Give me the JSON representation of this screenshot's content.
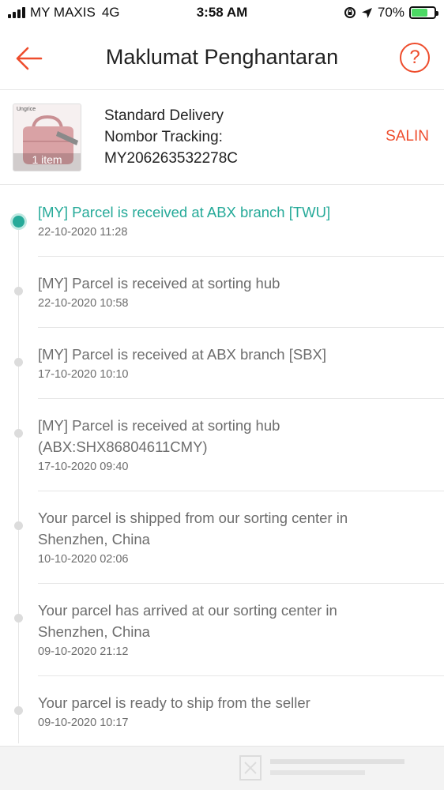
{
  "status_bar": {
    "carrier": "MY MAXIS",
    "network": "4G",
    "time": "3:58 AM",
    "battery": "70%",
    "battery_level": 0.7
  },
  "header": {
    "title": "Maklumat Penghantaran",
    "back_icon": "arrow-left-icon",
    "help_icon": "question-circle-icon",
    "help_label": "?"
  },
  "delivery": {
    "thumbnail_brand": "Ungrice",
    "item_count": "1 item",
    "method": "Standard Delivery",
    "tracking_label": "Nombor Tracking:",
    "tracking_number": "MY206263532278C",
    "copy_label": "SALIN"
  },
  "timeline": [
    {
      "desc_lines": [
        "[MY] Parcel is received at ABX branch [TWU]"
      ],
      "time": "22-10-2020 11:28",
      "active": true
    },
    {
      "desc_lines": [
        "[MY] Parcel is received at sorting hub"
      ],
      "time": "22-10-2020 10:58",
      "active": false
    },
    {
      "desc_lines": [
        "[MY] Parcel is received at ABX branch [SBX]"
      ],
      "time": "17-10-2020 10:10",
      "active": false
    },
    {
      "desc_lines": [
        "[MY] Parcel is received at sorting hub",
        "(ABX:SHX86804611CMY)"
      ],
      "time": "17-10-2020 09:40",
      "active": false
    },
    {
      "desc_lines": [
        "Your parcel is shipped from our sorting center in",
        "Shenzhen, China"
      ],
      "time": "10-10-2020 02:06",
      "active": false
    },
    {
      "desc_lines": [
        "Your parcel has arrived at our sorting center in",
        "Shenzhen, China"
      ],
      "time": "09-10-2020 21:12",
      "active": false
    },
    {
      "desc_lines": [
        "Your parcel is ready to ship from the seller"
      ],
      "time": "09-10-2020 10:17",
      "active": false
    }
  ],
  "colors": {
    "accent": "#ee4d2d",
    "active_status": "#26aa99",
    "inactive_dot": "#dcdcdc"
  }
}
